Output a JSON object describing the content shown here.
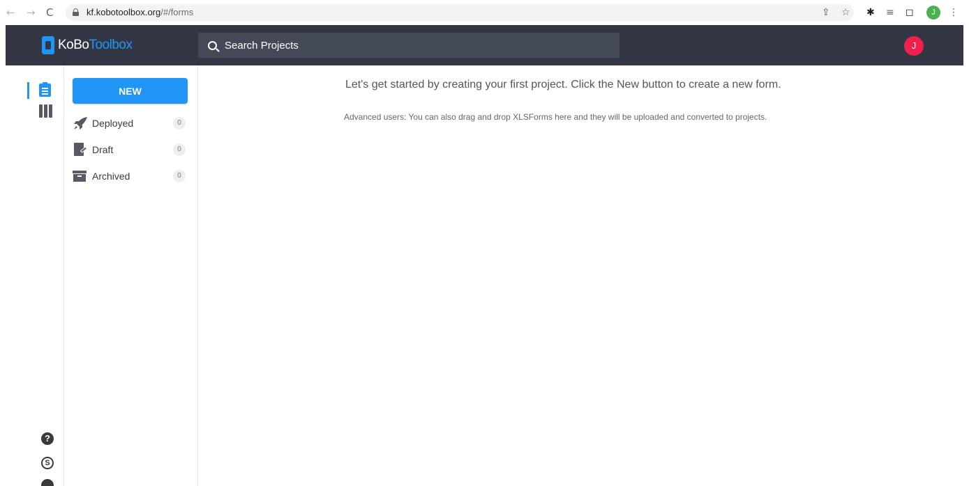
{
  "browser": {
    "back_icon": "arrow-left-icon",
    "forward_icon": "arrow-right-icon",
    "reload_icon": "reload-icon",
    "url_domain": "kf.kobotoolbox.org",
    "url_path": "/#/forms",
    "profile_initial": "J",
    "profile_color": "#4caf50"
  },
  "header": {
    "logo_part1": "KoBo",
    "logo_part2": "Toolbox",
    "search_placeholder": "Search Projects",
    "avatar_initial": "J",
    "avatar_color": "#f1214d",
    "background": "#333745",
    "accent": "#2095f3"
  },
  "rail": {
    "items": [
      {
        "icon": "forms-icon",
        "active": true
      },
      {
        "icon": "library-icon",
        "active": false
      }
    ],
    "bottom_icons": [
      "help-icon",
      "support-icon",
      "extra-icon"
    ]
  },
  "sidebar": {
    "new_label": "NEW",
    "filters": [
      {
        "label": "Deployed",
        "count": "0",
        "icon": "rocket-icon"
      },
      {
        "label": "Draft",
        "count": "0",
        "icon": "draft-icon"
      },
      {
        "label": "Archived",
        "count": "0",
        "icon": "archive-icon"
      }
    ]
  },
  "main": {
    "heading": "Let's get started by creating your first project. Click the New button to create a new form.",
    "subtext": "Advanced users: You can also drag and drop XLSForms here and they will be uploaded and converted to projects."
  }
}
